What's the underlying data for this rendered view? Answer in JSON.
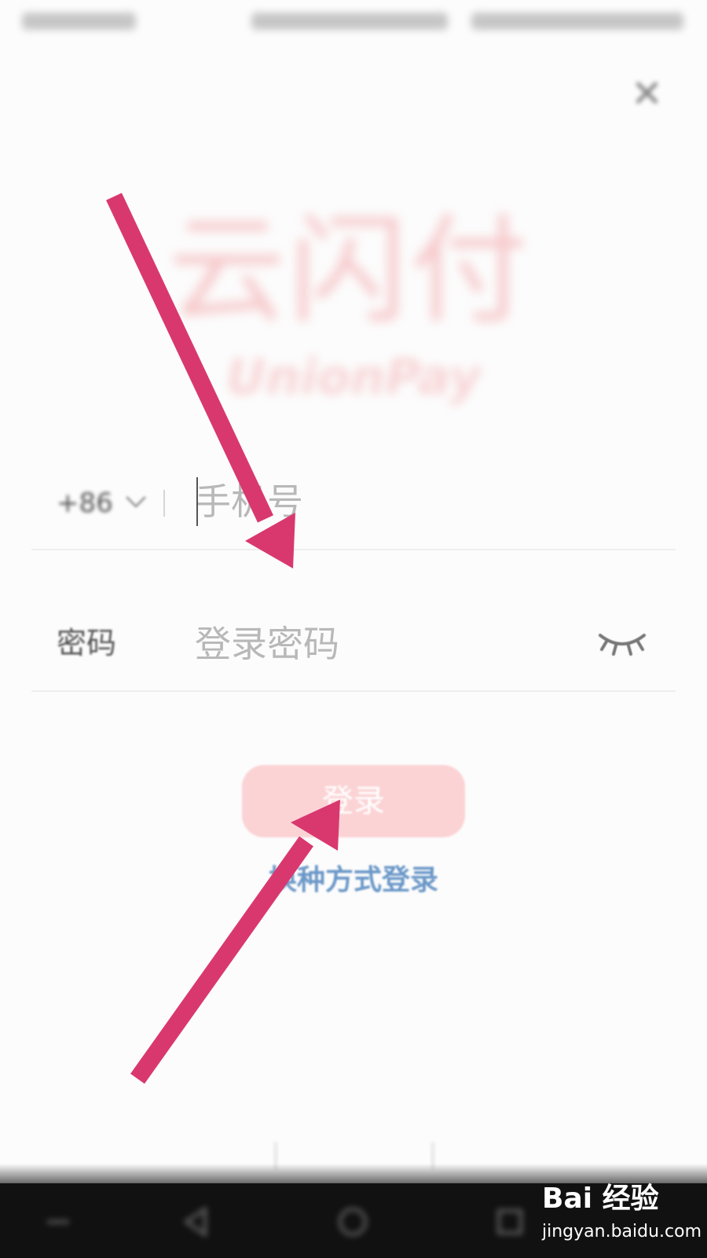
{
  "logo": {
    "chinese": "云闪付",
    "english": "UnionPay"
  },
  "phone": {
    "country_code": "+86",
    "placeholder": "手机号"
  },
  "password": {
    "label": "密码",
    "placeholder": "登录密码"
  },
  "login_button_label": "登录",
  "alt_login_label": "换种方式登录",
  "watermark": {
    "logo": "Bai 经验",
    "url": "jingyan.baidu.com"
  },
  "colors": {
    "accent_arrow": "#d9386f",
    "login_button": "#fbd3d5",
    "link": "#6b98c8"
  }
}
